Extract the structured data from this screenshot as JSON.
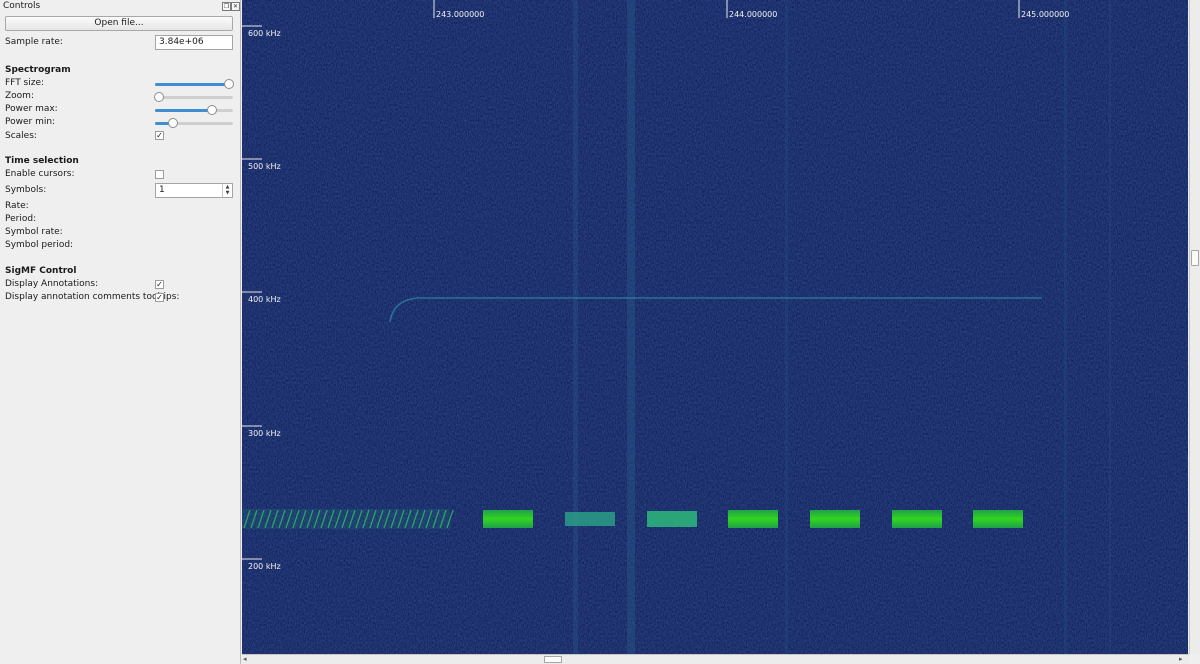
{
  "dock": {
    "title": "Controls",
    "float_icon": "float-icon",
    "close_icon": "close-icon"
  },
  "file": {
    "open_label": "Open file..."
  },
  "sample_rate": {
    "label": "Sample rate:",
    "value": "3.84e+06"
  },
  "spectrogram": {
    "heading": "Spectrogram",
    "fft_size": {
      "label": "FFT size:",
      "level": 1.0
    },
    "zoom": {
      "label": "Zoom:",
      "level": 0.0
    },
    "power_max": {
      "label": "Power max:",
      "level": 0.75
    },
    "power_min": {
      "label": "Power min:",
      "level": 0.2
    },
    "scales": {
      "label": "Scales:",
      "checked": true
    }
  },
  "time_selection": {
    "heading": "Time selection",
    "enable_cursors": {
      "label": "Enable cursors:",
      "checked": false
    },
    "symbols": {
      "label": "Symbols:",
      "value": "1"
    },
    "rate_label": "Rate:",
    "period_label": "Period:",
    "symbol_rate_label": "Symbol rate:",
    "symbol_period_label": "Symbol period:"
  },
  "sigmf": {
    "heading": "SigMF Control",
    "display_annotations": {
      "label": "Display Annotations:",
      "checked": true
    },
    "display_tooltips": {
      "label": "Display annotation comments tooltips:",
      "checked": true
    }
  },
  "plot": {
    "time_ticks": [
      "243.000000",
      "244.000000",
      "245.000000"
    ],
    "freq_ticks": [
      "600 kHz",
      "500 kHz",
      "400 kHz",
      "300 kHz",
      "200 kHz"
    ],
    "colors": {
      "background": "#0d1d58",
      "signal_strong": "#22c21c",
      "signal_weak": "#2a9e86",
      "trace": "#2c7ca0"
    }
  }
}
